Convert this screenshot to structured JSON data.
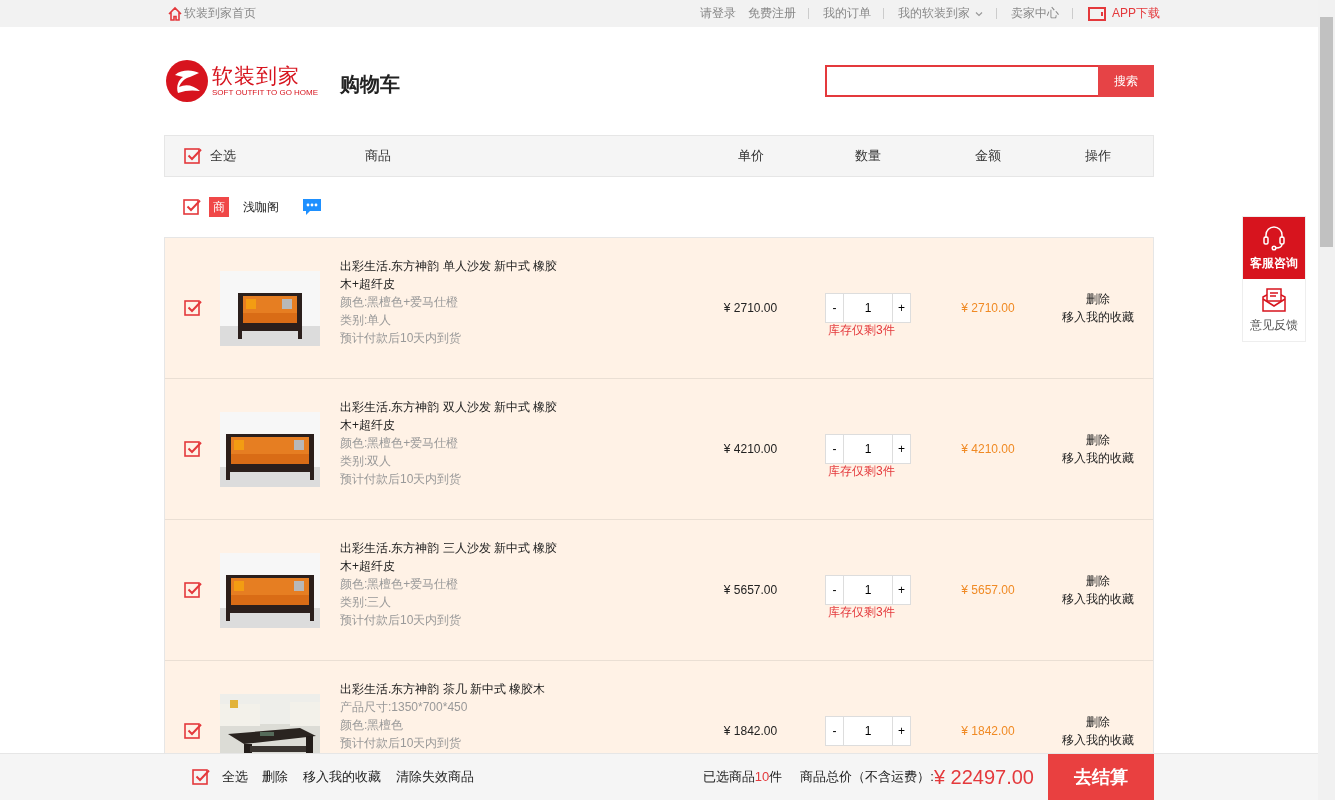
{
  "top_bar": {
    "home_link": "软装到家首页",
    "links": [
      {
        "label": "请登录",
        "divider": false,
        "has_menu": false
      },
      {
        "label": "免费注册",
        "divider": false,
        "has_menu": false
      },
      {
        "label": "我的订单",
        "divider": true,
        "has_menu": false
      },
      {
        "label": "我的软装到家",
        "divider": true,
        "has_menu": true
      },
      {
        "label": "卖家中心",
        "divider": true,
        "has_menu": false
      }
    ],
    "app_link": "APP下载"
  },
  "header": {
    "logo": {
      "name": "软装到家",
      "slogan": "SOFT OUTFIT TO GO HOME"
    },
    "page_title": "购物车",
    "search": {
      "button": "搜索"
    }
  },
  "table": {
    "select_all": {
      "label": "全选",
      "checked": true
    },
    "columns": [
      "商品",
      "单价",
      "数量",
      "金额",
      "操作"
    ]
  },
  "shop": {
    "checked": true,
    "badge": "商",
    "name": "浅咖阁"
  },
  "items": [
    {
      "checked": true,
      "kind": "sofa-1",
      "title": "出彩生活.东方神韵 单人沙发 新中式 橡胶木+超纤皮",
      "details": [
        "颜色:黑檀色+爱马仕橙",
        "类别:单人",
        "预计付款后10天内到货"
      ],
      "price": "¥ 2710.00",
      "minus": "-",
      "quantity": "1",
      "plus": "+",
      "stock": "库存仅剩3件",
      "amount": "¥ 2710.00",
      "actions": [
        "删除",
        "移入我的收藏"
      ]
    },
    {
      "checked": true,
      "kind": "sofa-2",
      "title": "出彩生活.东方神韵 双人沙发 新中式 橡胶木+超纤皮",
      "details": [
        "颜色:黑檀色+爱马仕橙",
        "类别:双人",
        "预计付款后10天内到货"
      ],
      "price": "¥ 4210.00",
      "minus": "-",
      "quantity": "1",
      "plus": "+",
      "stock": "库存仅剩3件",
      "amount": "¥ 4210.00",
      "actions": [
        "删除",
        "移入我的收藏"
      ]
    },
    {
      "checked": true,
      "kind": "sofa-3",
      "title": "出彩生活.东方神韵 三人沙发 新中式 橡胶木+超纤皮",
      "details": [
        "颜色:黑檀色+爱马仕橙",
        "类别:三人",
        "预计付款后10天内到货"
      ],
      "price": "¥ 5657.00",
      "minus": "-",
      "quantity": "1",
      "plus": "+",
      "stock": "库存仅剩3件",
      "amount": "¥ 5657.00",
      "actions": [
        "删除",
        "移入我的收藏"
      ]
    },
    {
      "checked": true,
      "kind": "table",
      "title": "出彩生活.东方神韵 茶几 新中式 橡胶木",
      "details": [
        "产品尺寸:1350*700*450",
        "颜色:黑檀色",
        "预计付款后10天内到货"
      ],
      "price": "¥ 1842.00",
      "minus": "-",
      "quantity": "1",
      "plus": "+",
      "amount": "¥ 1842.00",
      "actions": [
        "删除",
        "移入我的收藏"
      ]
    }
  ],
  "side_panel": [
    {
      "kind": "headset",
      "label": "客服咨询",
      "highlighted": true
    },
    {
      "kind": "mail",
      "label": "意见反馈",
      "highlighted": false
    }
  ],
  "footer": {
    "select_all": {
      "label": "全选",
      "checked": true
    },
    "actions": [
      "删除",
      "移入我的收藏",
      "清除失效商品"
    ],
    "selected_prefix": "已选商品",
    "selected_count": "10",
    "selected_unit": "件",
    "total_label": "商品总价（不含运费）:",
    "total": "¥ 22497.00",
    "checkout": "去结算"
  }
}
